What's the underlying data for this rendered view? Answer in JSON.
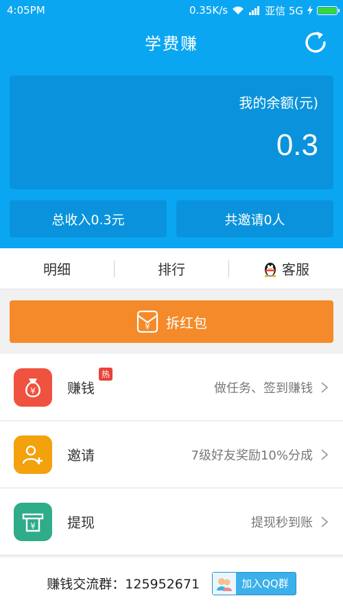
{
  "status_bar": {
    "time": "4:05PM",
    "speed": "0.35K/s",
    "carrier": "亚信 5G"
  },
  "header": {
    "title": "学费赚"
  },
  "balance": {
    "label": "我的余额(元)",
    "value": "0.3"
  },
  "stats": {
    "total_income": "总收入0.3元",
    "total_invites": "共邀请0人"
  },
  "tabs": [
    {
      "label": "明细"
    },
    {
      "label": "排行"
    },
    {
      "label": "客服"
    }
  ],
  "redpacket": {
    "label": "拆红包"
  },
  "rows": [
    {
      "label": "赚钱",
      "badge": "热",
      "desc": "做任务、签到赚钱",
      "color": "#ef5340",
      "icon": "money-bag-icon"
    },
    {
      "label": "邀请",
      "desc": "7级好友奖励10%分成",
      "color": "#f3a10c",
      "icon": "add-user-icon"
    },
    {
      "label": "提现",
      "desc": "提现秒到账",
      "color": "#2fac8a",
      "icon": "withdraw-icon"
    }
  ],
  "footer": {
    "group_text": "赚钱交流群：125952671",
    "join_label": "加入QQ群"
  },
  "colors": {
    "primary": "#0aa6f2",
    "card": "#0a93dc",
    "orange": "#f58a2a"
  }
}
